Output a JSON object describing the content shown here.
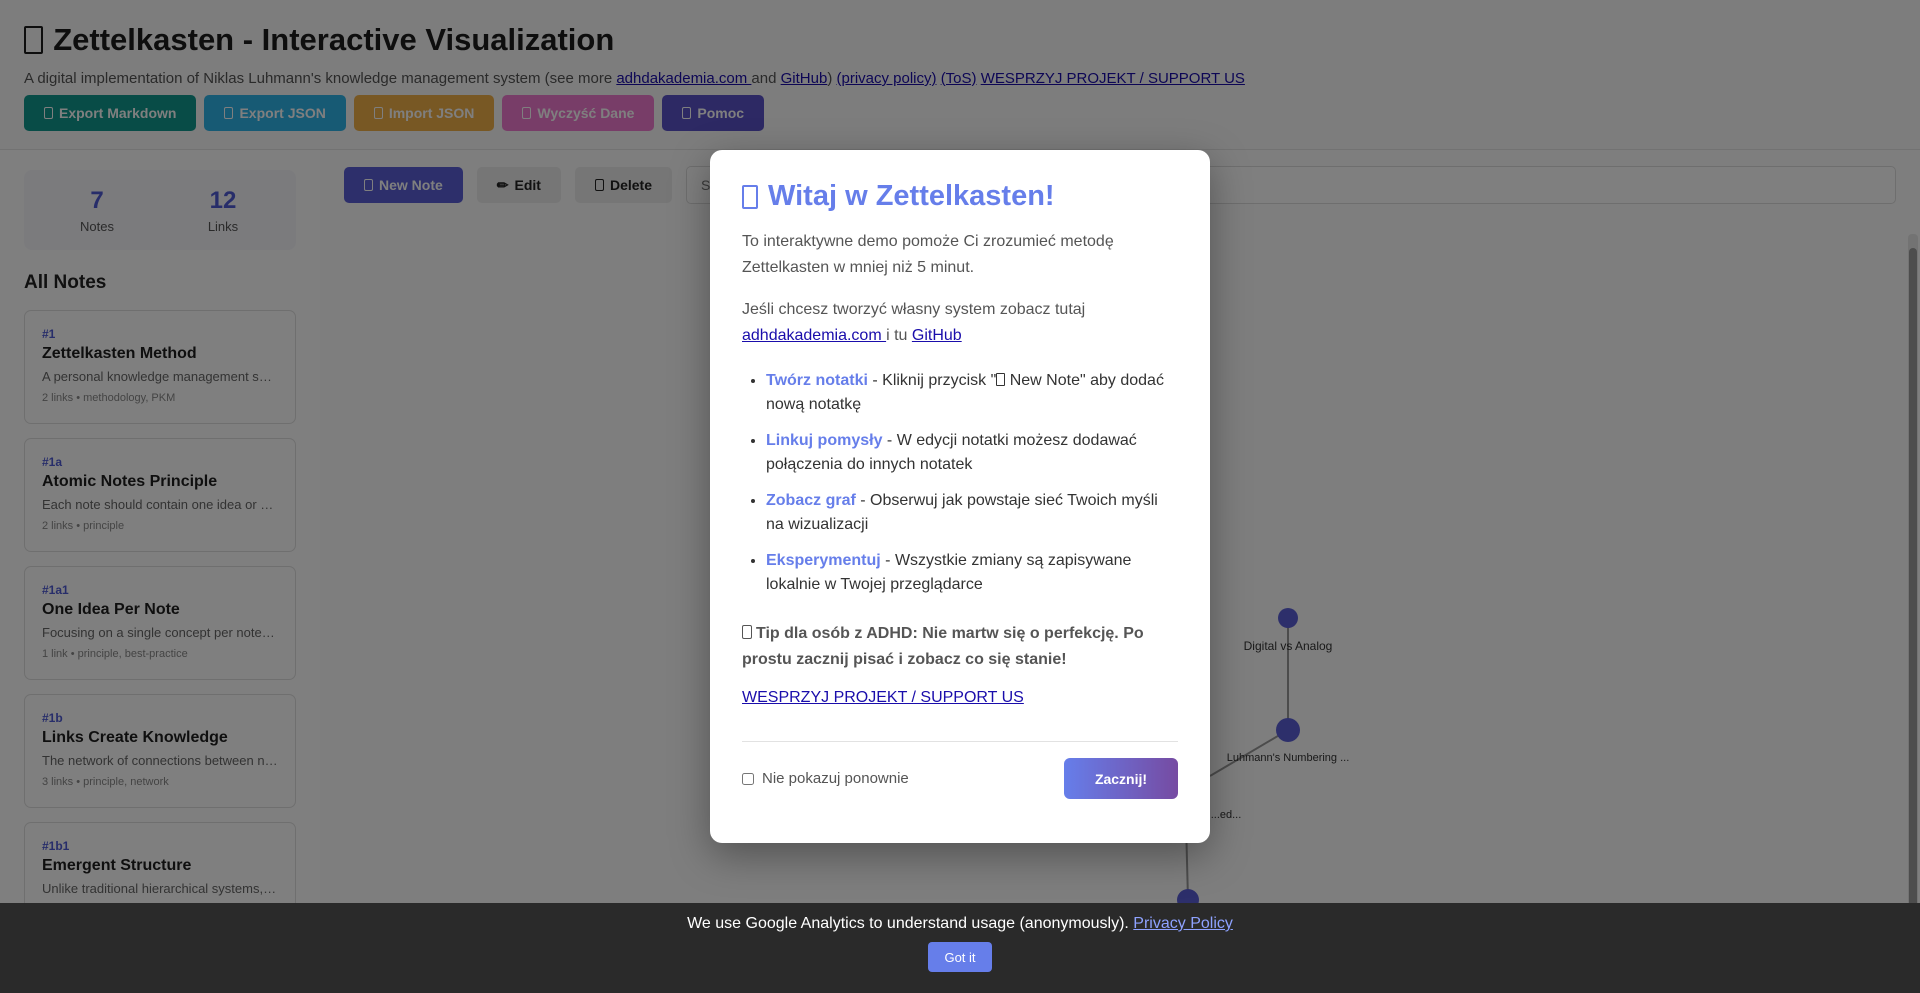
{
  "header": {
    "title": "Zettelkasten - Interactive Visualization",
    "title_icon": "card-index-icon",
    "subtitle_prefix": "A digital implementation of Niklas Luhmann's knowledge management system (see more ",
    "subtitle_link_site": "adhdakademia.com ",
    "subtitle_and": "and ",
    "subtitle_link_github": "GitHub",
    "subtitle_close": ") ",
    "subtitle_link_privacy": "(privacy policy)",
    "subtitle_link_tos": "(ToS)",
    "subtitle_link_support": "WESPRZYJ PROJEKT / SUPPORT US",
    "buttons": {
      "export_md": "Export Markdown",
      "export_json": "Export JSON",
      "import_json": "Import JSON",
      "clear": "Wyczyść Dane",
      "help": "Pomoc"
    },
    "colors": {
      "export_md": "#11998e",
      "export_json": "#2fb4e8",
      "import_json": "#f0b049",
      "clear": "#f07bd0",
      "help": "#5a52c8"
    }
  },
  "stats": {
    "notes_value": "7",
    "notes_label": "Notes",
    "links_value": "12",
    "links_label": "Links"
  },
  "sidebar": {
    "section_title": "All Notes",
    "notes": [
      {
        "id": "#1",
        "title": "Zettelkasten Method",
        "excerpt": "A personal knowledge management system that...",
        "meta": "2 links • methodology, PKM"
      },
      {
        "id": "#1a",
        "title": "Atomic Notes Principle",
        "excerpt": "Each note should contain one idea or concept...",
        "meta": "2 links • principle"
      },
      {
        "id": "#1a1",
        "title": "One Idea Per Note",
        "excerpt": "Focusing on a single concept per note improves...",
        "meta": "1 link • principle, best-practice"
      },
      {
        "id": "#1b",
        "title": "Links Create Knowledge",
        "excerpt": "The network of connections between notes...",
        "meta": "3 links • principle, network"
      },
      {
        "id": "#1b1",
        "title": "Emergent Structure",
        "excerpt": "Unlike traditional hierarchical systems, structure...",
        "meta": ""
      }
    ]
  },
  "main": {
    "new_note": "New Note",
    "edit": "Edit",
    "edit_icon": "✏",
    "delete": "Delete",
    "search_placeholder": "Search notes..."
  },
  "graph": {
    "node_labels": [
      "Digital vs Analog",
      "Luhmann's Numbering ...",
      "...ed..."
    ]
  },
  "modal": {
    "title": "Witaj w Zettelkasten!",
    "intro": "To interaktywne demo pomoże Ci zrozumieć metodę Zettelkasten w mniej niż 5 minut.",
    "find_more_text": "Jeśli chcesz tworzyć własny system zobacz tutaj ",
    "find_more_link_site": "adhdakademia.com ",
    "find_more_mid": "i tu ",
    "find_more_link_github": "GitHub",
    "features": [
      {
        "strong": "Twórz notatki",
        "pre": " - Kliknij przycisk \"",
        "post": " New Note\" aby dodać nową notatkę",
        "has_icon": true
      },
      {
        "strong": "Linkuj pomysły",
        "pre": " - W edycji notatki możesz dodawać połączenia do innych notatek",
        "post": "",
        "has_icon": false
      },
      {
        "strong": "Zobacz graf",
        "pre": " - Obserwuj jak powstaje sieć Twoich myśli na wizualizacji",
        "post": "",
        "has_icon": false
      },
      {
        "strong": "Eksperymentuj",
        "pre": " - Wszystkie zmiany są zapisywane lokalnie w Twojej przeglądarce",
        "post": "",
        "has_icon": false
      }
    ],
    "tip": "Tip dla osób z ADHD: Nie martw się o perfekcję. Po prostu zacznij pisać i zobacz co się stanie!",
    "support_link": "WESPRZYJ PROJEKT / SUPPORT US",
    "dont_show_label": "Nie pokazuj ponownie",
    "start_button": "Zacznij!"
  },
  "cookie": {
    "text": "We use Google Analytics to understand usage (anonymously). ",
    "link": "Privacy Policy",
    "button": "Got it"
  }
}
